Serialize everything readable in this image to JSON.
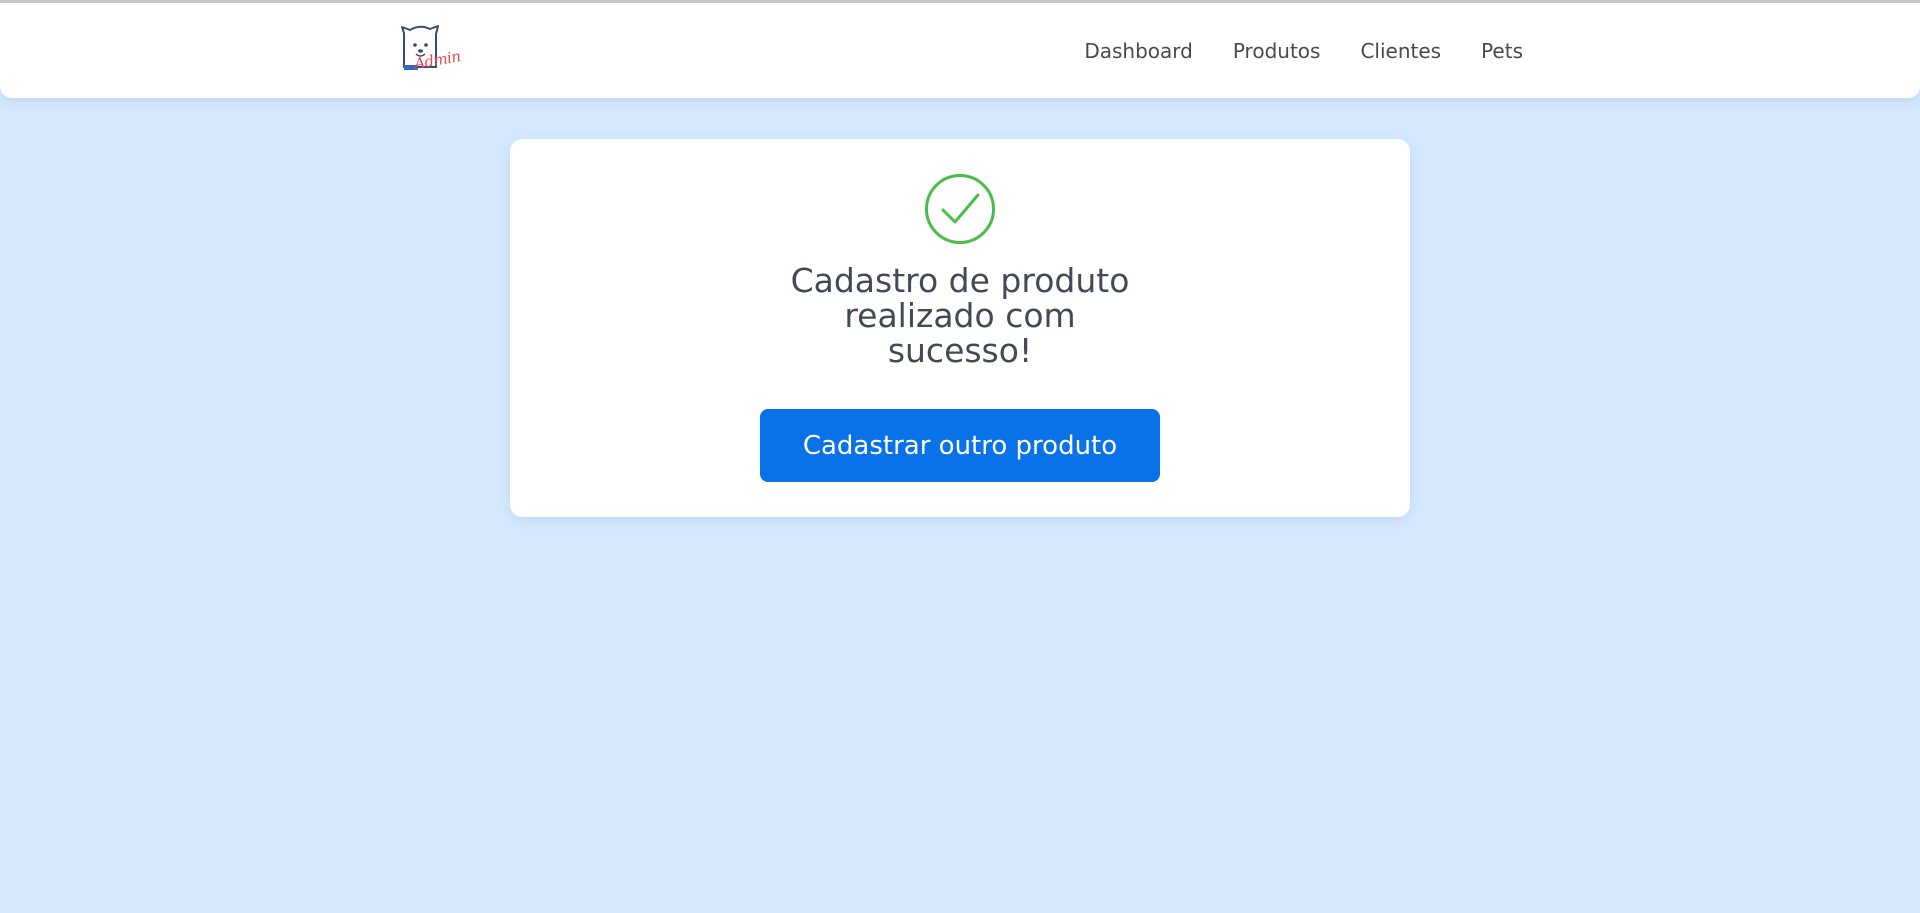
{
  "navbar": {
    "logo_text": "Admin",
    "links": [
      "Dashboard",
      "Produtos",
      "Clientes",
      "Pets"
    ]
  },
  "card": {
    "icon": "check-circle-icon",
    "title_lines": [
      "Cadastro de produto",
      "realizado com",
      "sucesso!"
    ],
    "button_label": "Cadastrar outro produto"
  },
  "colors": {
    "background": "#d5e8fd",
    "accent": "#0a72e8",
    "success": "#4cbb47",
    "logo_text": "#e8474c"
  }
}
